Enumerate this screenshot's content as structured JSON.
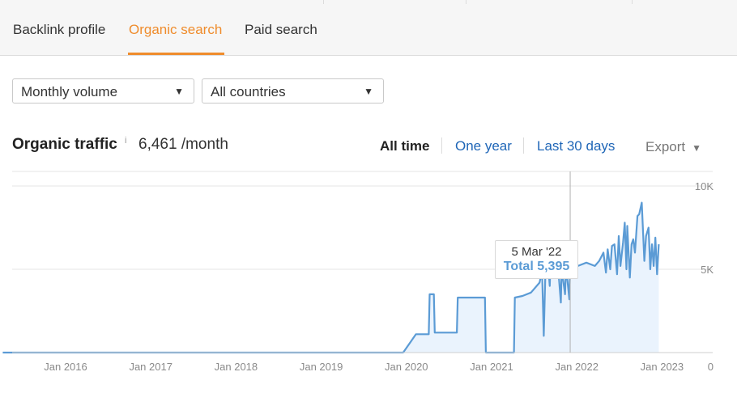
{
  "tabs": [
    {
      "label": "Backlink profile",
      "active": false
    },
    {
      "label": "Organic search",
      "active": true
    },
    {
      "label": "Paid search",
      "active": false
    }
  ],
  "filters": {
    "volume_select": "Monthly volume",
    "country_select": "All countries"
  },
  "header": {
    "title": "Organic traffic",
    "info": "i",
    "value": "6,461 /month"
  },
  "time_ranges": [
    {
      "label": "All time",
      "selected": true
    },
    {
      "label": "One year",
      "selected": false
    },
    {
      "label": "Last 30 days",
      "selected": false
    }
  ],
  "export_label": "Export",
  "icons": {
    "dropdown": "caret-down-icon",
    "info": "info-icon"
  },
  "colors": {
    "accent": "#ef8c2c",
    "link": "#1f66b7",
    "series": "#5b9bd5",
    "area": "#eaf3fd"
  },
  "tooltip": {
    "date": "5 Mar '22",
    "total": "Total 5,395"
  },
  "chart_data": {
    "type": "area",
    "title": "Organic traffic",
    "xlabel": "",
    "ylabel": "",
    "ylim": [
      0,
      10000
    ],
    "y_ticks": [
      {
        "value": 10000,
        "label": "10K"
      },
      {
        "value": 5000,
        "label": "5K"
      },
      {
        "value": 0,
        "label": "0"
      }
    ],
    "x_ticks": [
      {
        "value": 2016.0,
        "label": "Jan 2016"
      },
      {
        "value": 2017.0,
        "label": "Jan 2017"
      },
      {
        "value": 2018.0,
        "label": "Jan 2018"
      },
      {
        "value": 2019.0,
        "label": "Jan 2019"
      },
      {
        "value": 2020.0,
        "label": "Jan 2020"
      },
      {
        "value": 2021.0,
        "label": "Jan 2021"
      },
      {
        "value": 2022.0,
        "label": "Jan 2022"
      },
      {
        "value": 2023.0,
        "label": "Jan 2023"
      }
    ],
    "grid": true,
    "series": [
      {
        "values": [
          [
            2015.5,
            0
          ],
          [
            2020.2,
            0
          ],
          [
            2020.35,
            1100
          ],
          [
            2020.5,
            1100
          ],
          [
            2020.51,
            3500
          ],
          [
            2020.56,
            3500
          ],
          [
            2020.57,
            1200
          ],
          [
            2020.83,
            1200
          ],
          [
            2020.84,
            3300
          ],
          [
            2021.16,
            3300
          ],
          [
            2021.17,
            0
          ],
          [
            2021.5,
            0
          ],
          [
            2021.51,
            3300
          ],
          [
            2021.6,
            3400
          ],
          [
            2021.7,
            3600
          ],
          [
            2021.8,
            4200
          ],
          [
            2021.83,
            4900
          ],
          [
            2021.85,
            1000
          ],
          [
            2021.87,
            5000
          ],
          [
            2021.9,
            5300
          ],
          [
            2021.92,
            4000
          ],
          [
            2021.93,
            5500
          ],
          [
            2022.0,
            4500
          ],
          [
            2022.02,
            5000
          ],
          [
            2022.05,
            3000
          ],
          [
            2022.06,
            5000
          ],
          [
            2022.1,
            3500
          ],
          [
            2022.11,
            5200
          ],
          [
            2022.15,
            3200
          ],
          [
            2022.16,
            5395
          ],
          [
            2022.25,
            5200
          ],
          [
            2022.35,
            5400
          ],
          [
            2022.45,
            5200
          ],
          [
            2022.5,
            5500
          ],
          [
            2022.55,
            6000
          ],
          [
            2022.58,
            4800
          ],
          [
            2022.6,
            6200
          ],
          [
            2022.63,
            5000
          ],
          [
            2022.65,
            6400
          ],
          [
            2022.68,
            6500
          ],
          [
            2022.71,
            4700
          ],
          [
            2022.73,
            7000
          ],
          [
            2022.75,
            5200
          ],
          [
            2022.78,
            6600
          ],
          [
            2022.8,
            7800
          ],
          [
            2022.82,
            5000
          ],
          [
            2022.83,
            7600
          ],
          [
            2022.86,
            4500
          ],
          [
            2022.88,
            6500
          ],
          [
            2022.9,
            6800
          ],
          [
            2022.92,
            6000
          ],
          [
            2022.95,
            8200
          ],
          [
            2022.97,
            8300
          ],
          [
            2023.0,
            9000
          ],
          [
            2023.03,
            5500
          ],
          [
            2023.05,
            7000
          ],
          [
            2023.08,
            7500
          ],
          [
            2023.1,
            5000
          ],
          [
            2023.12,
            6500
          ],
          [
            2023.14,
            5200
          ],
          [
            2023.16,
            6900
          ],
          [
            2023.18,
            4700
          ],
          [
            2023.2,
            6500
          ]
        ]
      }
    ],
    "hover": {
      "x": 2022.16,
      "y": 5395
    }
  }
}
